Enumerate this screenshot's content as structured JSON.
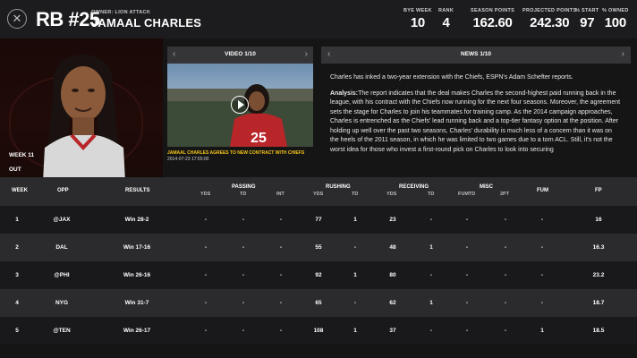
{
  "header": {
    "close_icon": "close-icon",
    "position_number": "RB #25",
    "owner_label": "OWNER: LION ATTACK",
    "player_name": "JAMAAL CHARLES",
    "stats": [
      {
        "label": "BYE WEEK",
        "value": "10"
      },
      {
        "label": "RANK",
        "value": "4"
      },
      {
        "label": "SEASON POINTS",
        "value": "162.60"
      },
      {
        "label": "PROJECTED POINTS",
        "value": "242.30"
      },
      {
        "label": "% START",
        "value": "97"
      },
      {
        "label": "% OWNED",
        "value": "100"
      }
    ]
  },
  "player_panel": {
    "week_label": "WEEK 11",
    "status": "OUT"
  },
  "video": {
    "title": "VIDEO 1/10",
    "caption": "JAMAAL CHARLES AGREES TO NEW CONTRACT WITH CHIEFS",
    "date": "2014-07-23 17:55:00"
  },
  "news": {
    "title": "NEWS 1/10",
    "headline": "Charles has inked a two-year extension with the Chiefs, ESPN's Adam Schefter reports.",
    "analysis_label": "Analysis:",
    "analysis_text": "The report indicates that the deal makes Charles the second-highest paid running back in the league, with his contract with the Chiefs now running for the next four seasons. Moreover, the agreement sets the stage for Charles to join his teammates for training camp. As the 2014 campaign approaches, Charles is entrenched as the Chiefs' lead running back and a top-tier fantasy option at the position. After holding up well over the past two seasons, Charles' durability is much less of a concern than it was on the heels of the 2011 season, in which he was limited to two games due to a torn ACL. Still, it's not the worst idea for those who invest a first-round pick on Charles to look into securing"
  },
  "table": {
    "columns": {
      "week": "WEEK",
      "opp": "OPP",
      "results": "RESULTS",
      "passing": "PASSING",
      "rushing": "RUSHING",
      "receiving": "RECEIVING",
      "misc": "MISC",
      "fum": "FUM",
      "fp": "FP",
      "yds": "YDS",
      "td": "TD",
      "int": "INT",
      "fumtd": "FUMTD",
      "twopt": "2PT"
    },
    "rows": [
      {
        "week": "1",
        "opp": "@JAX",
        "result": "Win 28-2",
        "pyds": "-",
        "ptd": "-",
        "int": "-",
        "ryds": "77",
        "rtd": "1",
        "recyds": "23",
        "rectd": "-",
        "fumtd": "-",
        "twopt": "-",
        "fum": "-",
        "fp": "16"
      },
      {
        "week": "2",
        "opp": "DAL",
        "result": "Win 17-16",
        "pyds": "-",
        "ptd": "-",
        "int": "-",
        "ryds": "55",
        "rtd": "-",
        "recyds": "48",
        "rectd": "1",
        "fumtd": "-",
        "twopt": "-",
        "fum": "-",
        "fp": "16.3"
      },
      {
        "week": "3",
        "opp": "@PHI",
        "result": "Win 26-16",
        "pyds": "-",
        "ptd": "-",
        "int": "-",
        "ryds": "92",
        "rtd": "1",
        "recyds": "80",
        "rectd": "-",
        "fumtd": "-",
        "twopt": "-",
        "fum": "-",
        "fp": "23.2"
      },
      {
        "week": "4",
        "opp": "NYG",
        "result": "Win 31-7",
        "pyds": "-",
        "ptd": "-",
        "int": "-",
        "ryds": "65",
        "rtd": "-",
        "recyds": "62",
        "rectd": "1",
        "fumtd": "-",
        "twopt": "-",
        "fum": "-",
        "fp": "18.7"
      },
      {
        "week": "5",
        "opp": "@TEN",
        "result": "Win 26-17",
        "pyds": "-",
        "ptd": "-",
        "int": "-",
        "ryds": "108",
        "rtd": "1",
        "recyds": "37",
        "rectd": "-",
        "fumtd": "-",
        "twopt": "-",
        "fum": "1",
        "fp": "18.5"
      }
    ]
  }
}
